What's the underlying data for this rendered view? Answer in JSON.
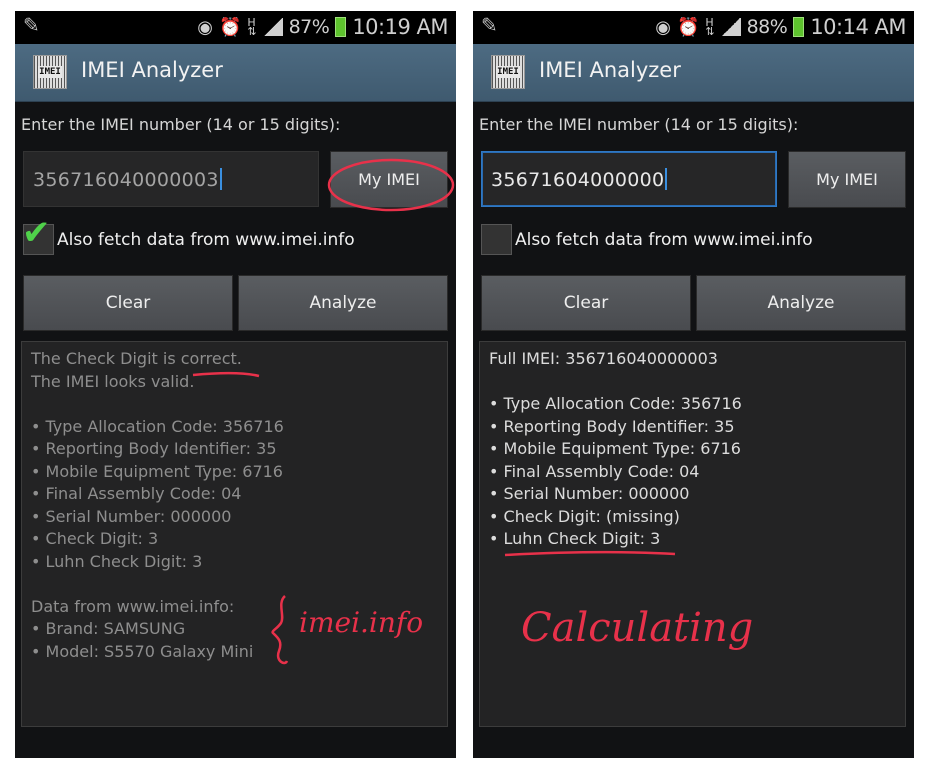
{
  "left": {
    "status": {
      "battery_pct": "87%",
      "time": "10:19 AM"
    },
    "app_title": "IMEI Analyzer",
    "app_icon_text": "IMEI",
    "prompt": "Enter the IMEI number (14 or 15 digits):",
    "imei_value": "356716040000003",
    "my_imei_label": "My IMEI",
    "fetch_label": "Also fetch data from www.imei.info",
    "fetch_checked": true,
    "clear_label": "Clear",
    "analyze_label": "Analyze",
    "result_lines": [
      "The Check Digit is correct.",
      "The IMEI looks valid.",
      "",
      "• Type Allocation Code: 356716",
      "• Reporting Body Identifier: 35",
      "• Mobile Equipment Type: 6716",
      "• Final Assembly Code: 04",
      "• Serial Number: 000000",
      "• Check Digit: 3",
      "• Luhn Check Digit: 3",
      "",
      "Data from www.imei.info:",
      "• Brand: SAMSUNG",
      "• Model: S5570 Galaxy Mini"
    ],
    "annotation": "imei.info"
  },
  "right": {
    "status": {
      "battery_pct": "88%",
      "time": "10:14 AM"
    },
    "app_title": "IMEI Analyzer",
    "app_icon_text": "IMEI",
    "prompt": "Enter the IMEI number (14 or 15 digits):",
    "imei_value": "35671604000000",
    "my_imei_label": "My IMEI",
    "fetch_label": "Also fetch data from www.imei.info",
    "fetch_checked": false,
    "clear_label": "Clear",
    "analyze_label": "Analyze",
    "result_lines": [
      "Full IMEI: 356716040000003",
      "",
      "• Type Allocation Code: 356716",
      "• Reporting Body Identifier: 35",
      "• Mobile Equipment Type: 6716",
      "• Final Assembly Code: 04",
      "• Serial Number: 000000",
      "• Check Digit: (missing)",
      "• Luhn Check Digit: 3"
    ],
    "annotation": "Calculating"
  },
  "colors": {
    "titlebar": "#46627a",
    "annotation_red": "#e8314a",
    "checkmark_green": "#4fd14a",
    "battery_green": "#5ec32e",
    "focus_blue": "#2f78c4"
  },
  "icons": [
    "pencil-icon",
    "eye-icon",
    "alarm-icon",
    "hplus-data-icon",
    "signal-icon",
    "battery-icon",
    "app-barcode-icon",
    "checkmark-icon"
  ]
}
